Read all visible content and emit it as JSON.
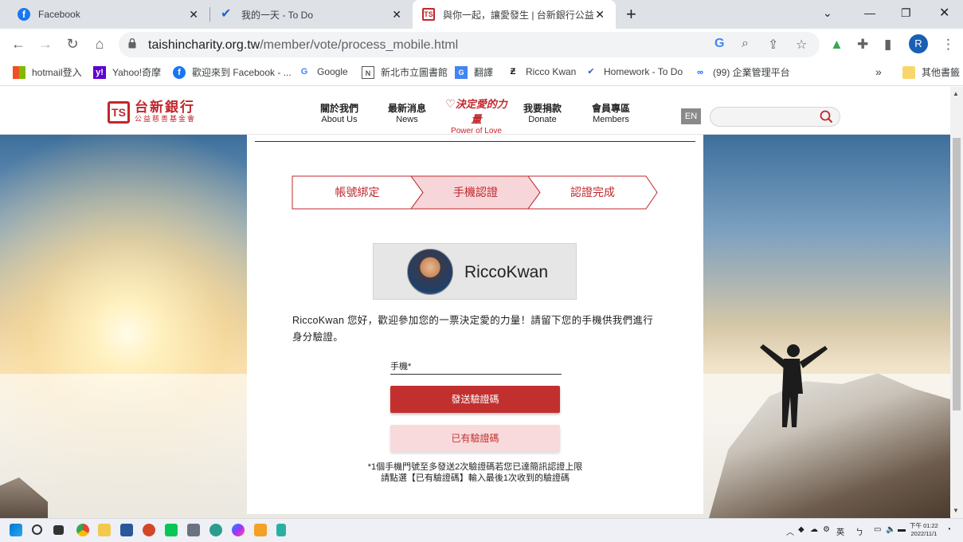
{
  "browser": {
    "tabs": [
      {
        "title": "Facebook",
        "icon": "facebook-icon"
      },
      {
        "title": "我的一天 - To Do",
        "icon": "todo-icon"
      },
      {
        "title": "與你一起，讓愛發生 | 台新銀行公益慈善",
        "icon": "taishin-icon"
      }
    ],
    "url_host": "taishincharity.org.tw",
    "url_path": "/member/vote/process_mobile.html",
    "profile_initial": "R",
    "bookmarks": [
      {
        "label": "hotmail登入",
        "icon": "microsoft-icon"
      },
      {
        "label": "Yahoo!奇摩",
        "icon": "yahoo-icon"
      },
      {
        "label": "歡迎來到 Facebook - ...",
        "icon": "facebook-icon"
      },
      {
        "label": "Google",
        "icon": "google-icon"
      },
      {
        "label": "新北市立圖書館",
        "icon": "library-icon"
      },
      {
        "label": "翻譯",
        "icon": "translate-icon"
      },
      {
        "label": "Ricco Kwan",
        "icon": "ricco-icon"
      },
      {
        "label": "Homework - To Do",
        "icon": "todo-icon"
      },
      {
        "label": "(99) 企業管理平台",
        "icon": "meta-icon"
      }
    ],
    "more_bookmarks_chevron": "»",
    "other_bookmarks": "其他書籤"
  },
  "site": {
    "logo_main": "台新銀行",
    "logo_sub": "公益慈善基金會",
    "logo_mark": "TS",
    "menu": [
      {
        "zh": "關於我們",
        "en": "About Us"
      },
      {
        "zh": "最新消息",
        "en": "News"
      },
      {
        "zh": "我要捐款",
        "en": "Donate"
      },
      {
        "zh": "會員專區",
        "en": "Members"
      }
    ],
    "power_zh": "決定愛的力量",
    "power_en": "Power of Love",
    "lang": "EN"
  },
  "steps": [
    "帳號綁定",
    "手機認證",
    "認證完成"
  ],
  "active_step_index": 1,
  "profile": {
    "name": "RiccoKwan"
  },
  "greeting": "RiccoKwan  您好，歡迎參加您的一票決定愛的力量！請留下您的手機供我們進行身分驗證。",
  "phone": {
    "label": "手機*",
    "value": ""
  },
  "buttons": {
    "send": "發送驗證碼",
    "have": "已有驗證碼"
  },
  "note": {
    "line1": "*1個手機門號至多發送2次驗證碼若您已達簡訊認證上限",
    "line2": "請點選【已有驗證碼】輸入最後1次收到的驗證碼"
  },
  "taskbar": {
    "ime": "英",
    "time": "下午 01:22",
    "date": "2022/11/1"
  },
  "colors": {
    "brand_red": "#c1272d",
    "button_red": "#c1302f",
    "button_pink": "#f9dadc",
    "active_step_bg": "#f6d6d8"
  }
}
